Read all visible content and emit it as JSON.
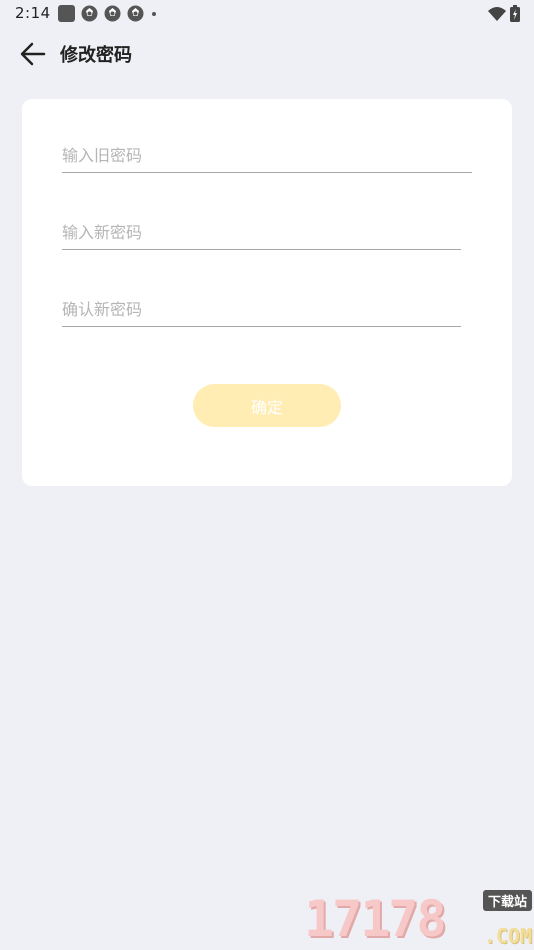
{
  "status_bar": {
    "time": "2:14",
    "icons": [
      "app-square-icon",
      "aperture-icon",
      "aperture-icon",
      "aperture-icon",
      "notification-dot-icon",
      "wifi-icon",
      "battery-charging-icon"
    ]
  },
  "header": {
    "back_icon": "arrow-left-icon",
    "title": "修改密码"
  },
  "form": {
    "old_password_placeholder": "输入旧密码",
    "new_password_placeholder": "输入新密码",
    "confirm_password_placeholder": "确认新密码",
    "submit_label": "确定"
  },
  "colors": {
    "background": "#eff0f5",
    "card": "#ffffff",
    "button": "#ffedb4",
    "button_text": "#ffffff",
    "underline": "#a6a6a6",
    "placeholder": "#b5b5b5"
  },
  "watermark": {
    "number": "17178",
    "badge": "下载站",
    "suffix": ".COM"
  }
}
